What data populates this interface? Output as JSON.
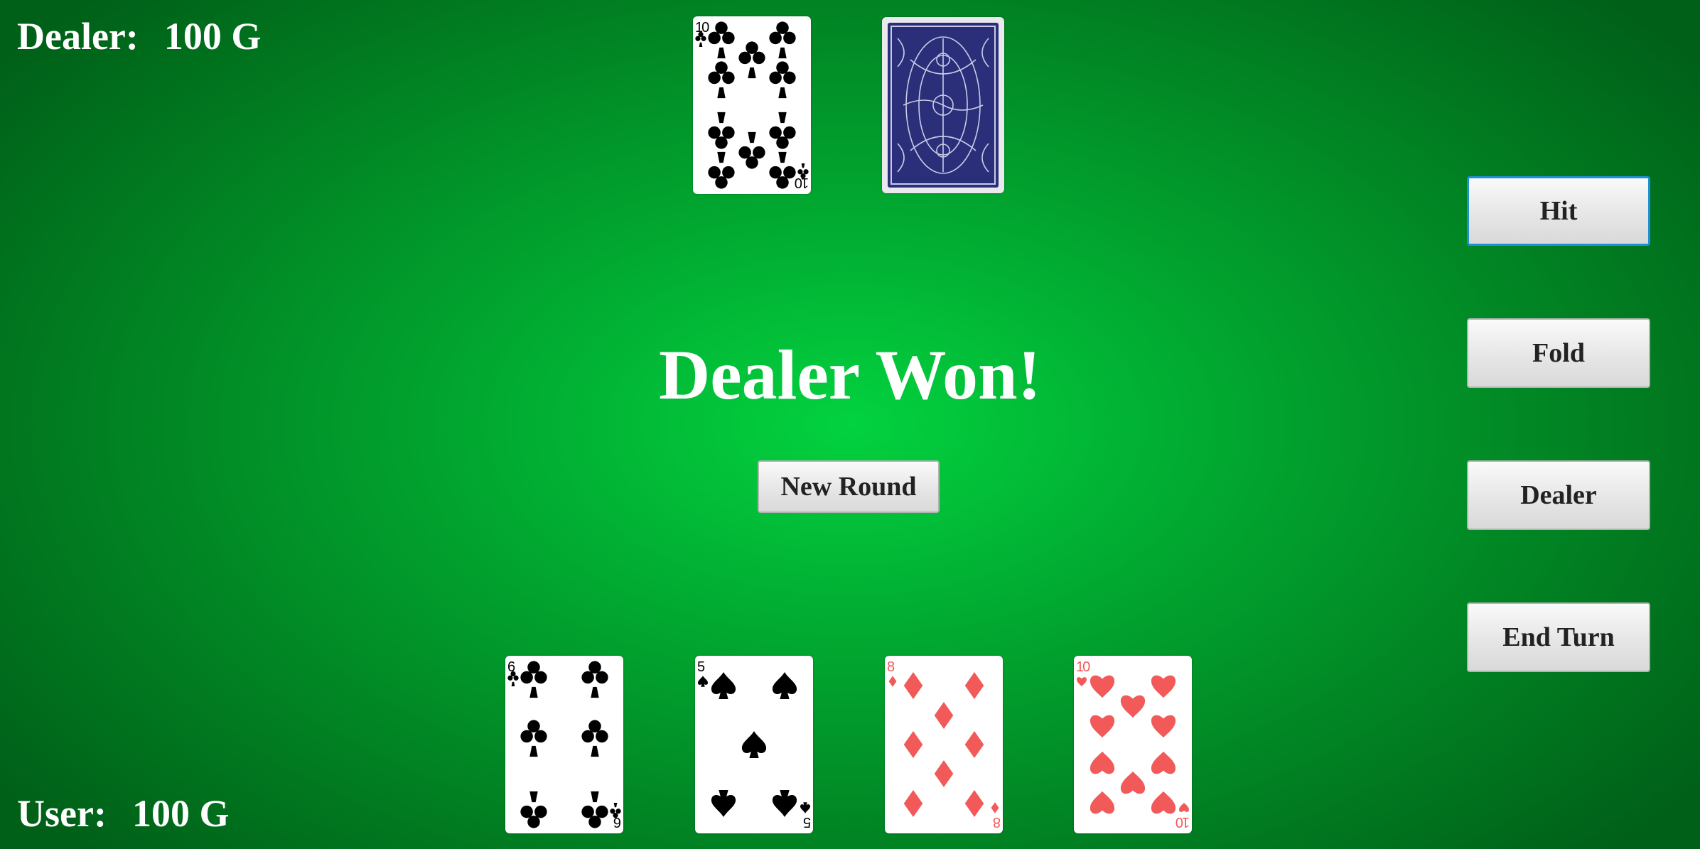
{
  "dealer": {
    "label": "Dealer:",
    "amount": "100 G",
    "cards": [
      {
        "rank": "10",
        "suit": "clubs",
        "face": "up"
      },
      {
        "face": "down"
      }
    ]
  },
  "user": {
    "label": "User:",
    "amount": "100 G",
    "cards": [
      {
        "rank": "6",
        "suit": "clubs",
        "face": "up"
      },
      {
        "rank": "5",
        "suit": "spades",
        "face": "up"
      },
      {
        "rank": "8",
        "suit": "diamonds",
        "face": "up"
      },
      {
        "rank": "10",
        "suit": "hearts",
        "face": "up"
      }
    ]
  },
  "message": "Dealer Won!",
  "buttons": {
    "new_round": "New Round",
    "hit": "Hit",
    "fold": "Fold",
    "dealer": "Dealer",
    "end_turn": "End Turn"
  },
  "colors": {
    "red_suit": "#f25a5a",
    "black_suit": "#000000",
    "card_back": "#2b2f7a",
    "focus_border": "#1f8fd8"
  },
  "icons": {
    "clubs": "club-icon",
    "spades": "spade-icon",
    "diamonds": "diamond-icon",
    "hearts": "heart-icon"
  }
}
